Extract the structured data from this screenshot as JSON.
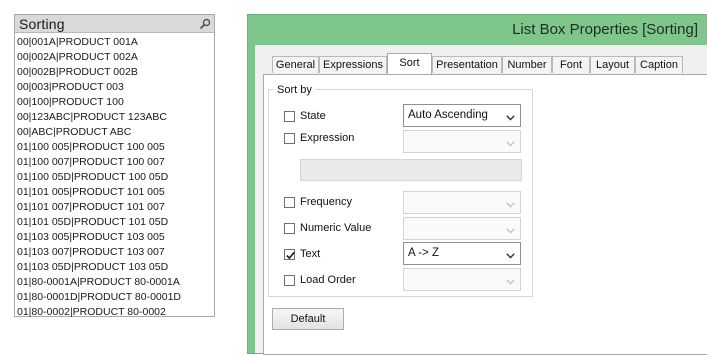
{
  "listbox": {
    "title": "Sorting",
    "items": [
      "00|001A|PRODUCT 001A",
      "00|002A|PRODUCT 002A",
      "00|002B|PRODUCT 002B",
      "00|003|PRODUCT 003",
      "00|100|PRODUCT 100",
      "00|123ABC|PRODUCT 123ABC",
      "00|ABC|PRODUCT ABC",
      "01|100 005|PRODUCT 100 005",
      "01|100 007|PRODUCT 100 007",
      "01|100 05D|PRODUCT 100 05D",
      "01|101 005|PRODUCT 101 005",
      "01|101 007|PRODUCT 101 007",
      "01|101 05D|PRODUCT 101 05D",
      "01|103 005|PRODUCT 103 005",
      "01|103 007|PRODUCT 103 007",
      "01|103 05D|PRODUCT 103 05D",
      "01|80-0001A|PRODUCT 80-0001A",
      "01|80-0001D|PRODUCT 80-0001D",
      "01|80-0002|PRODUCT 80-0002"
    ]
  },
  "dialog": {
    "title": "List Box Properties [Sorting]",
    "tabs": [
      "General",
      "Expressions",
      "Sort",
      "Presentation",
      "Number",
      "Font",
      "Layout",
      "Caption"
    ],
    "active_tab": "Sort",
    "sort_by": {
      "title": "Sort by",
      "state": {
        "label": "State",
        "checked": false,
        "value": "Auto Ascending"
      },
      "expression": {
        "label": "Expression",
        "checked": false,
        "value": ""
      },
      "frequency": {
        "label": "Frequency",
        "checked": false,
        "value": ""
      },
      "numeric_value": {
        "label": "Numeric Value",
        "checked": false,
        "value": ""
      },
      "text": {
        "label": "Text",
        "checked": true,
        "value": "A -> Z"
      },
      "load_order": {
        "label": "Load Order",
        "checked": false,
        "value": ""
      }
    },
    "default_button": "Default"
  },
  "colors": {
    "dialog_frame": "#7ec68a",
    "listbox_caption": "#d9d9d9"
  }
}
